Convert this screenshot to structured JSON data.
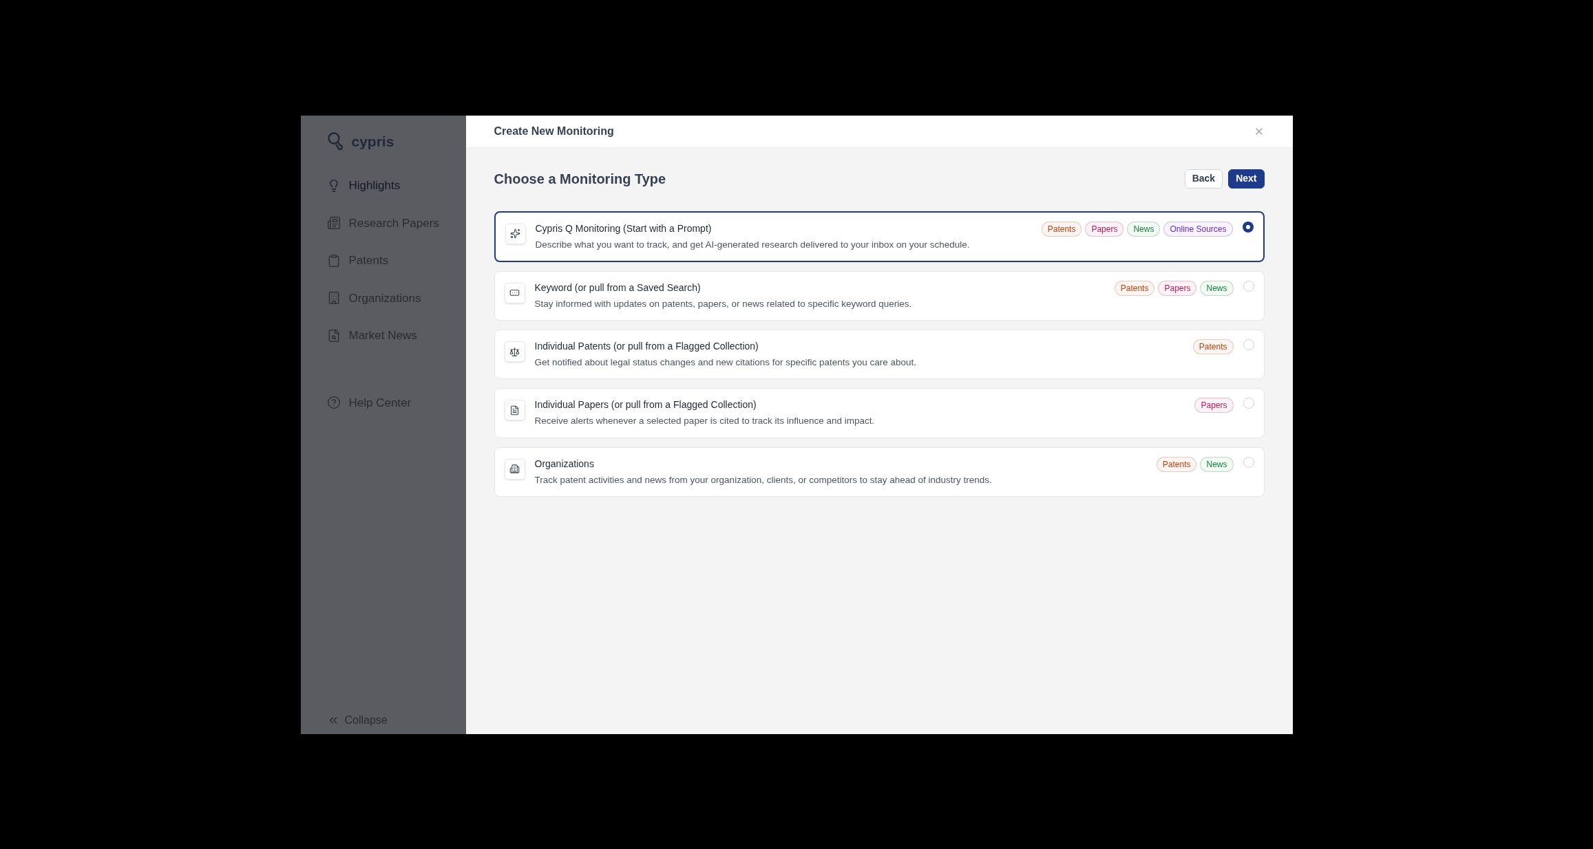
{
  "sidebar": {
    "logo": "cypris",
    "items": [
      {
        "label": "Highlights",
        "selected": true
      },
      {
        "label": "Research Papers",
        "selected": false
      },
      {
        "label": "Patents",
        "selected": false
      },
      {
        "label": "Organizations",
        "selected": false
      },
      {
        "label": "Market News",
        "selected": false
      }
    ],
    "footer_items": [
      {
        "label": "Help Center"
      }
    ],
    "collapse": "Collapse"
  },
  "dialog": {
    "title": "Create New Monitoring",
    "heading": "Choose a Monitoring Type",
    "buttons": [
      {
        "label": "Back",
        "kind": "secondary"
      },
      {
        "label": "Next",
        "kind": "primary"
      }
    ],
    "options": [
      {
        "title": "Cypris Q Monitoring (Start with a Prompt)",
        "description": "Describe what you want to track, and get AI-generated research delivered to your inbox on your schedule.",
        "selected": true,
        "tags": [
          {
            "label": "Patents",
            "color": "#c2410c"
          },
          {
            "label": "Papers",
            "color": "#be185d"
          },
          {
            "label": "News",
            "color": "#15803d"
          },
          {
            "label": "Online Sources",
            "color": "#6d28d9"
          }
        ]
      },
      {
        "title": "Keyword (or pull from a Saved Search)",
        "description": "Stay informed with updates on patents, papers, or news related to specific keyword queries.",
        "selected": false,
        "tags": [
          {
            "label": "Patents",
            "color": "#c2410c"
          },
          {
            "label": "Papers",
            "color": "#be185d"
          },
          {
            "label": "News",
            "color": "#15803d"
          }
        ]
      },
      {
        "title": "Individual Patents (or pull from a Flagged Collection)",
        "description": "Get notified about legal status changes and new citations for specific patents you care about.",
        "selected": false,
        "tags": [
          {
            "label": "Patents",
            "color": "#c2410c"
          }
        ]
      },
      {
        "title": "Individual Papers (or pull from a Flagged Collection)",
        "description": "Receive alerts whenever a selected paper is cited to track its influence and impact.",
        "selected": false,
        "tags": [
          {
            "label": "Papers",
            "color": "#be185d"
          }
        ]
      },
      {
        "title": "Organizations",
        "description": "Track patent activities and news from your organization, clients, or competitors to stay ahead of industry trends.",
        "selected": false,
        "tags": [
          {
            "label": "Patents",
            "color": "#c2410c"
          },
          {
            "label": "News",
            "color": "#15803d"
          }
        ]
      }
    ]
  }
}
